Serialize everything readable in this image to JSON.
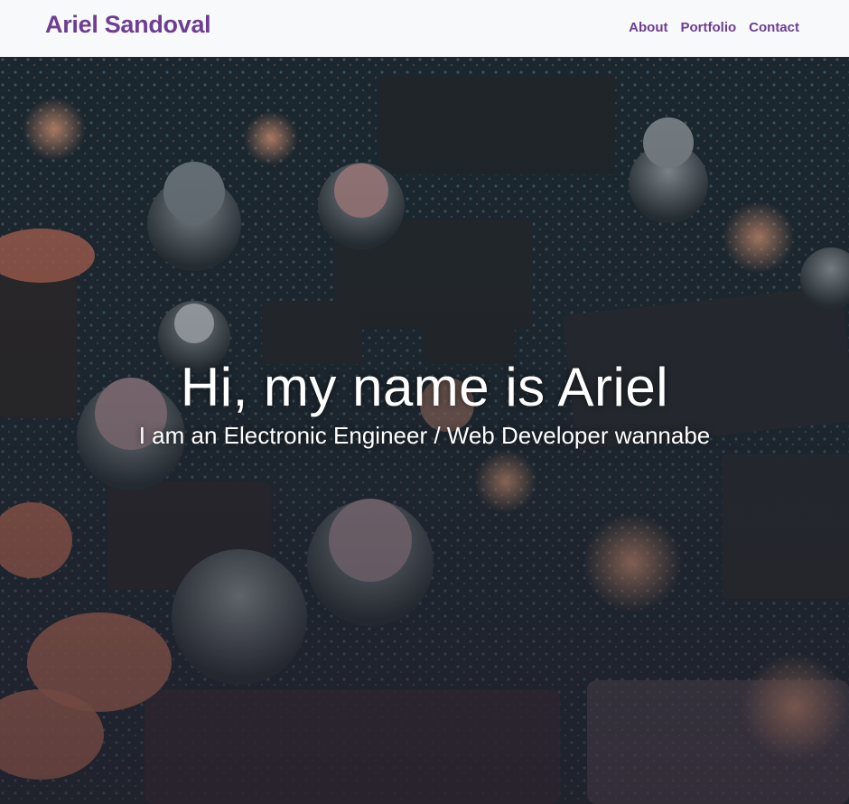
{
  "navbar": {
    "brand": "Ariel Sandoval",
    "links": [
      {
        "label": "About"
      },
      {
        "label": "Portfolio"
      },
      {
        "label": "Contact"
      }
    ]
  },
  "hero": {
    "title": "Hi, my name is Ariel",
    "subtitle": "I am an Electronic Engineer / Web Developer wannabe"
  },
  "colors": {
    "accent": "#6d3e92",
    "navbar_bg": "#f8f9fb",
    "hero_text": "#ffffff"
  }
}
